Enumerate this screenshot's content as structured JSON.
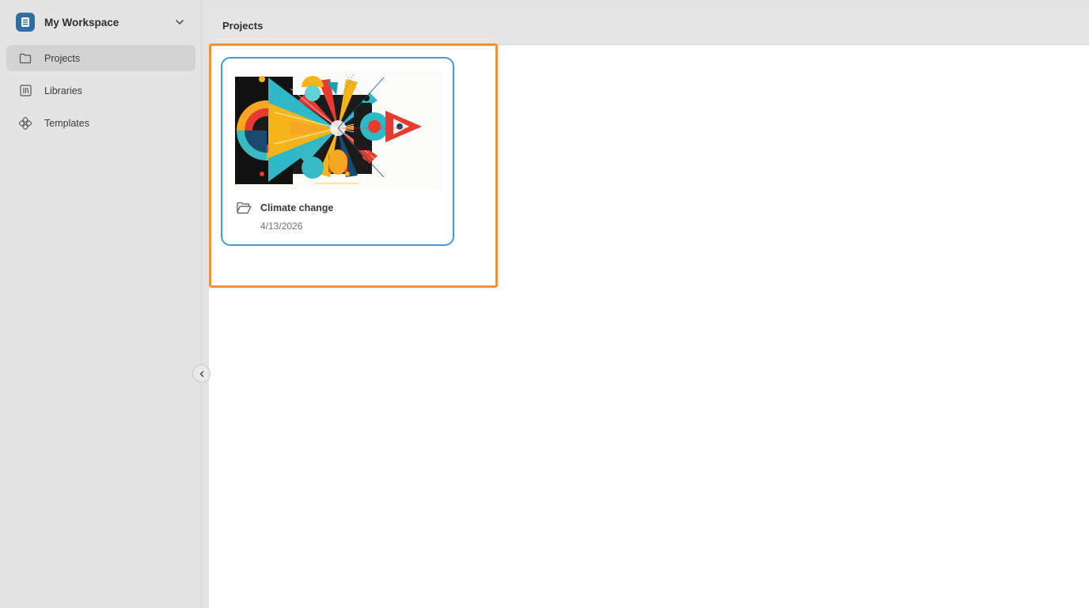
{
  "workspace": {
    "name": "My Workspace",
    "logo_icon": "workspace-logo-icon",
    "chevron_icon": "chevron-down-icon",
    "accent": "#2f6f9f"
  },
  "sidebar": {
    "items": [
      {
        "label": "Projects",
        "icon": "folder-icon",
        "active": true
      },
      {
        "label": "Libraries",
        "icon": "library-icon",
        "active": false
      },
      {
        "label": "Templates",
        "icon": "templates-icon",
        "active": false
      }
    ],
    "collapse_icon": "chevron-left-icon"
  },
  "header": {
    "title": "Projects"
  },
  "projects": [
    {
      "title": "Climate change",
      "date": "4/13/2026",
      "icon": "folder-open-icon",
      "thumbnail": "abstract-geometric-artwork"
    }
  ],
  "colors": {
    "highlight": "#f0923a",
    "card_border": "#3aa0d8"
  }
}
